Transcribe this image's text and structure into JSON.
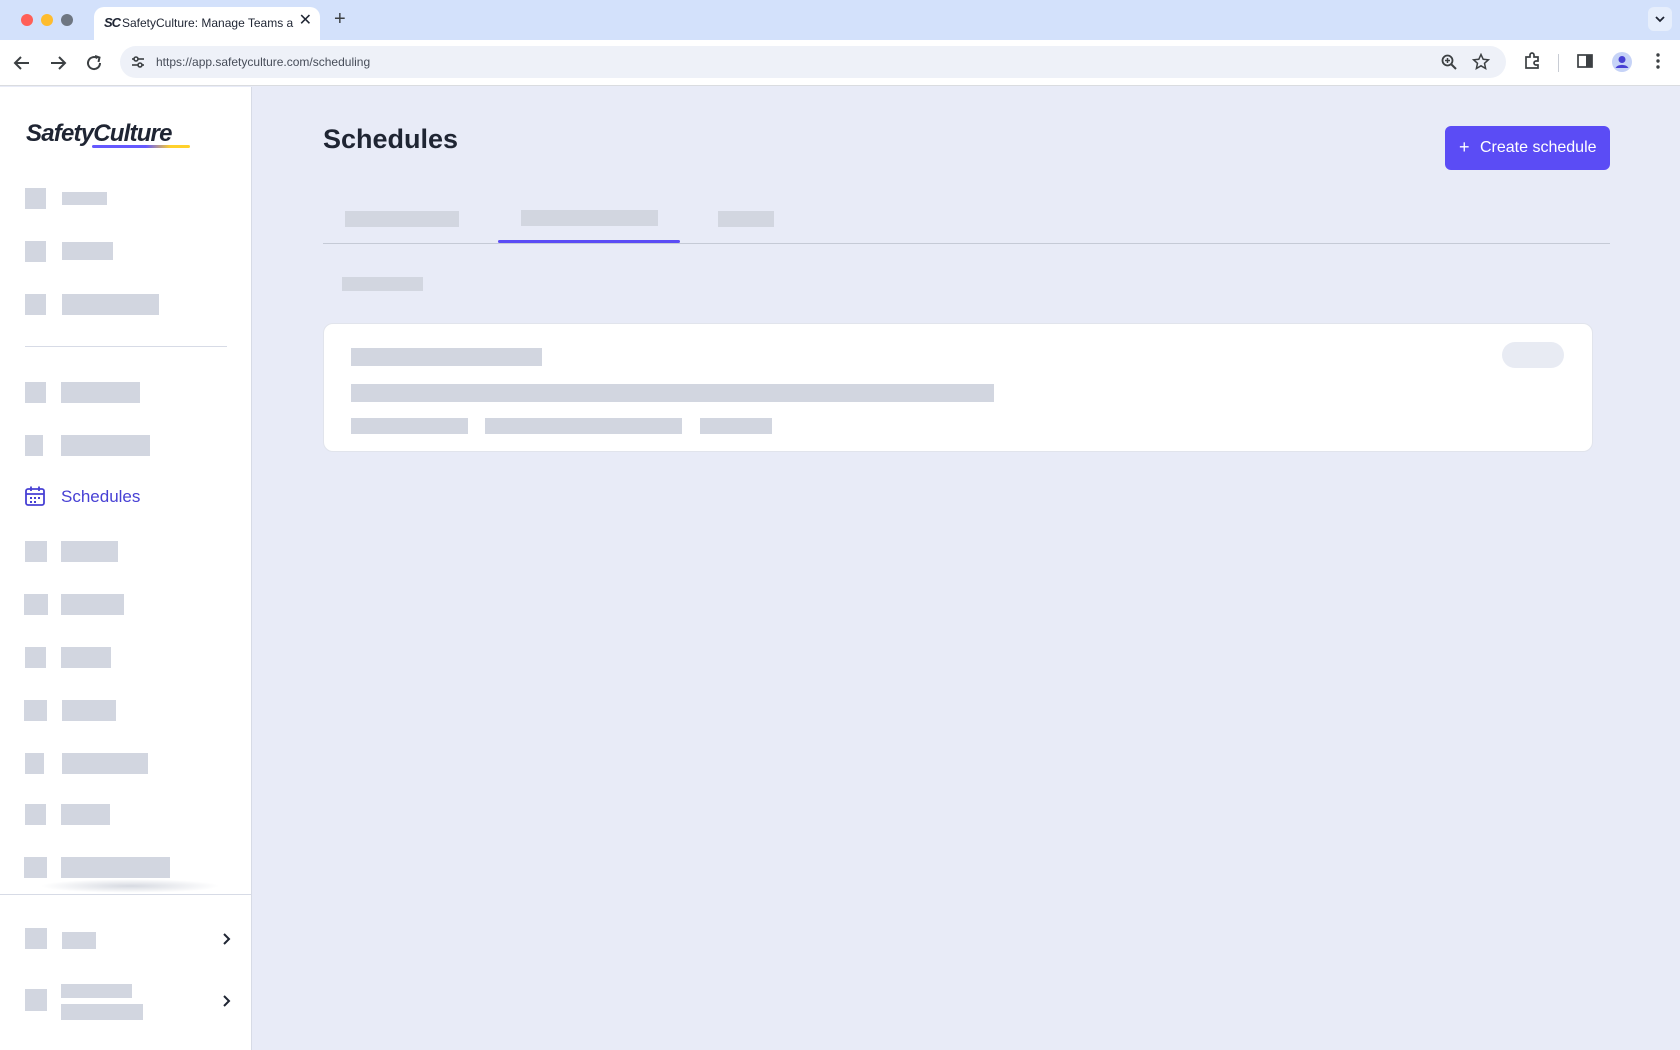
{
  "browser": {
    "tab_title": "SafetyCulture: Manage Teams and...",
    "tab_favicon_text": "SC",
    "url": "https://app.safetyculture.com/scheduling",
    "close_glyph": "✕",
    "new_tab_glyph": "+",
    "icons": [
      "back-icon",
      "forward-icon",
      "reload-icon",
      "site-settings-icon",
      "zoom-icon",
      "bookmark-star-icon",
      "extensions-icon",
      "side-panel-icon",
      "profile-icon",
      "more-menu-icon",
      "tab-list-icon"
    ]
  },
  "sidebar": {
    "logo_text": "SafetyCulture",
    "active_item": {
      "label": "Schedules",
      "icon": "calendar-icon"
    },
    "accent_color": "#4740d4"
  },
  "main": {
    "title": "Schedules",
    "create_button": {
      "plus": "+",
      "label": "Create schedule"
    },
    "colors": {
      "primary": "#5b4cf5",
      "skeleton": "#d2d6e0",
      "background": "#e8ebf7"
    }
  }
}
